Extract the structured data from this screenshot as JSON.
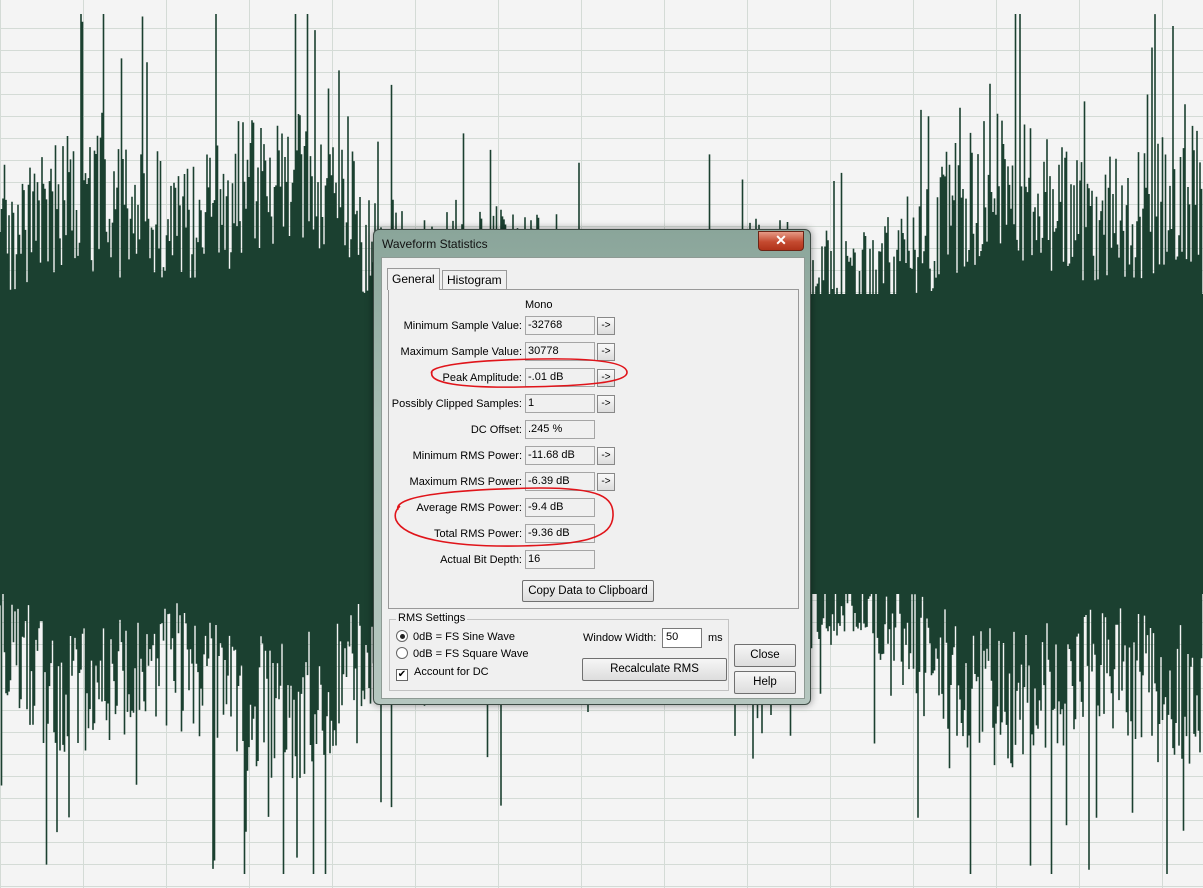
{
  "colors": {
    "waveform": "#1b4030",
    "grid_background": "#f4f4f4",
    "gridline": "#d4dbd6",
    "annotation": "#e0141a",
    "close_button": "#c44a30"
  },
  "dialog": {
    "title": "Waveform Statistics",
    "close_glyph": "✕",
    "tabs": [
      {
        "label": "General"
      },
      {
        "label": "Histogram"
      }
    ],
    "column_header": "Mono",
    "arrow_glyph": "->",
    "rows": [
      {
        "label": "Minimum Sample Value:",
        "value": "-32768"
      },
      {
        "label": "Maximum Sample Value:",
        "value": "30778"
      },
      {
        "label": "Peak Amplitude:",
        "value": "-.01 dB"
      },
      {
        "label": "Possibly Clipped Samples:",
        "value": "1"
      },
      {
        "label": "DC Offset:",
        "value": ".245 %"
      },
      {
        "label": "Minimum RMS Power:",
        "value": "-11.68 dB"
      },
      {
        "label": "Maximum RMS Power:",
        "value": "-6.39 dB"
      },
      {
        "label": "Average RMS Power:",
        "value": "-9.4 dB"
      },
      {
        "label": "Total RMS Power:",
        "value": "-9.36 dB"
      },
      {
        "label": "Actual Bit Depth:",
        "value": "16"
      }
    ],
    "copy_button": "Copy Data to Clipboard",
    "rms_settings": {
      "title": "RMS Settings",
      "options": [
        {
          "label": "0dB = FS Sine Wave",
          "selected": true
        },
        {
          "label": "0dB = FS Square Wave",
          "selected": false
        }
      ],
      "account_for_dc": {
        "label": "Account for DC",
        "checked": true,
        "glyph": "✔"
      },
      "window_width_label": "Window Width:",
      "window_width_value": "50",
      "window_width_unit": "ms",
      "recalculate_button": "Recalculate RMS"
    },
    "close_button": "Close",
    "help_button": "Help"
  }
}
